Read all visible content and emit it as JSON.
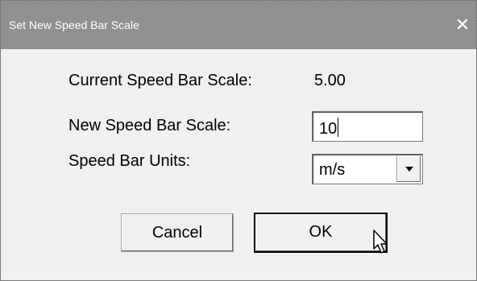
{
  "window": {
    "title": "Set New Speed Bar Scale",
    "close_glyph": "✕"
  },
  "form": {
    "current_label": "Current Speed Bar Scale:",
    "current_value": "5.00",
    "new_label": "New Speed Bar Scale:",
    "new_value": "10",
    "units_label": "Speed Bar Units:",
    "units_value": "m/s"
  },
  "buttons": {
    "cancel": "Cancel",
    "ok": "OK"
  },
  "icons": {
    "close": "close-icon",
    "dropdown": "chevron-down-icon",
    "cursor": "mouse-pointer-icon"
  }
}
